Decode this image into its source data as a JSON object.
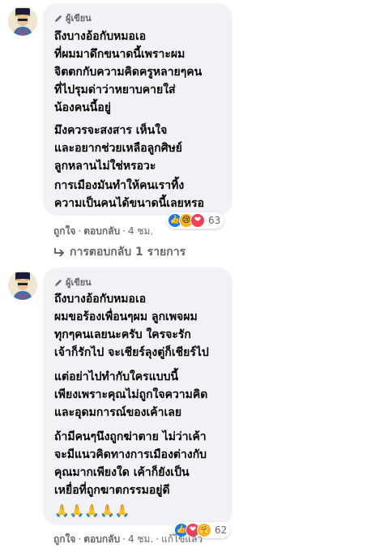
{
  "comments": [
    {
      "author_label": "ผู้เขียน",
      "paragraphs": [
        [
          "ถึงบางอ้อกับหมอเอ",
          "ที่ผมมาดึกขนาดนี้เพราะผม",
          "จิตตกกับความคิดครูหลายๆคน",
          "ที่ไปรุมด่าว่าหยาบคายใส่",
          "น้องคนนี้อยู่"
        ],
        [
          "มึงควรจะสงสาร เห็นใจ",
          "และอยากช่วยเหลือลูกศิษย์",
          "ลูกหลานไม่ใช่หรอวะ"
        ],
        [
          "การเมืองมันทำให้คนเราทิ้ง",
          "ความเป็นคนได้ขนาดนี้เลยหรอ"
        ]
      ],
      "reactions": [
        "like",
        "sad",
        "love"
      ],
      "reaction_count": "63",
      "actions": {
        "like": "ถูกใจ",
        "reply": "ตอบกลับ",
        "time": "4 ชม."
      }
    },
    {
      "author_label": "ผู้เขียน",
      "paragraphs": [
        [
          "ถึงบางอ้อกับหมอเอ",
          "ผมขอร้องเพื่อนๆผม ลูกเพจผม",
          "ทุกๆคนเลยนะครับ ใครจะรัก",
          "เจ้าก็รักไป จะเชียร์ลุงตู่ก็เชียร์ไป"
        ],
        [
          "แต่อย่าไปทำกับใครแบบนี้",
          "เพียงเพราะคุณไม่ถูกใจความคิด",
          "และอุดมการณ์ของเค้าเลย"
        ],
        [
          "ถ้ามีคนๆนึงถูกฆ่าตาย ไม่ว่าเค้า",
          "จะมีแนวคิดทางการเมืองต่างกับ",
          "คุณมากเพียงใด เค้าก็ยังเป็น",
          "เหยื่อที่ถูกฆาตกรรมอยู่ดี"
        ]
      ],
      "emoji_line": "🙏🙏🙏🙏🙏",
      "reactions": [
        "like",
        "love",
        "care"
      ],
      "reaction_count": "62",
      "actions": {
        "like": "ถูกใจ",
        "reply": "ตอบกลับ",
        "time": "4 ชม.",
        "edited": "แก้ไขแล้ว"
      }
    }
  ],
  "replies_link": "การตอบกลับ 1 รายการ",
  "icons": {
    "reply_arrow": "reply-arrow-icon",
    "author_badge": "pen-icon"
  },
  "colors": {
    "bubble": "#f0f2f5",
    "muted": "#65676b",
    "like": "#1877f2",
    "love": "#f33e58",
    "sad": "#f7b125"
  }
}
